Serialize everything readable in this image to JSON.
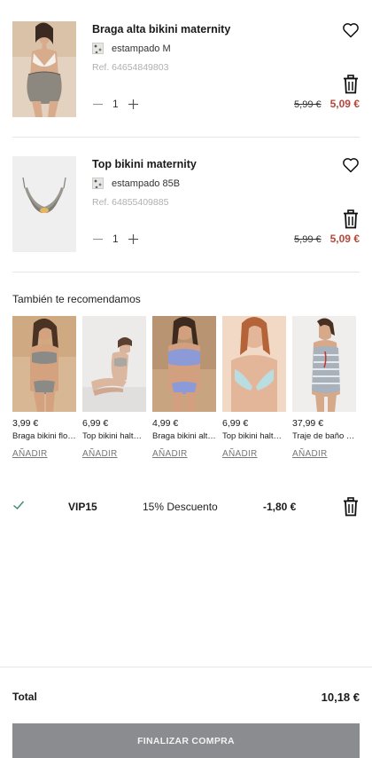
{
  "cart": {
    "items": [
      {
        "name": "Braga alta bikini maternity",
        "variant": "estampado M",
        "ref": "Ref. 64654849803",
        "quantity": "1",
        "old_price": "5,99 €",
        "new_price": "5,09 €"
      },
      {
        "name": "Top bikini maternity",
        "variant": "estampado 85B",
        "ref": "Ref. 64855409885",
        "quantity": "1",
        "old_price": "5,99 €",
        "new_price": "5,09 €"
      }
    ]
  },
  "recommendations": {
    "title": "También te recomendamos",
    "add_label": "AÑADIR",
    "products": [
      {
        "price": "3,99 €",
        "name": "Braga bikini flo…"
      },
      {
        "price": "6,99 €",
        "name": "Top bikini halt…"
      },
      {
        "price": "4,99 €",
        "name": "Braga bikini alt…"
      },
      {
        "price": "6,99 €",
        "name": "Top bikini halt…"
      },
      {
        "price": "37,99 €",
        "name": "Traje de baño …"
      }
    ]
  },
  "promo": {
    "code": "VIP15",
    "description": "15% Descuento",
    "amount": "-1,80 €"
  },
  "summary": {
    "total_label": "Total",
    "total_value": "10,18 €",
    "checkout_label": "FINALIZAR COMPRA"
  },
  "colors": {
    "sale_price": "#b5473a",
    "checkout_button": "#8a8c8f",
    "check_icon": "#3a8a6a"
  }
}
